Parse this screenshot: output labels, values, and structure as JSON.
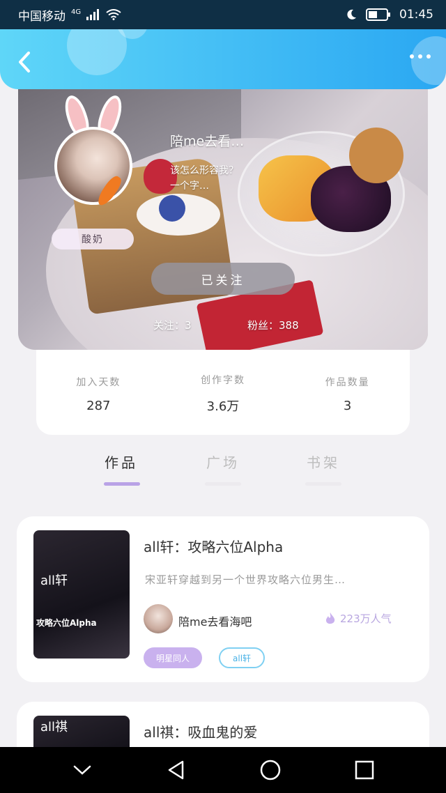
{
  "status_bar": {
    "carrier": "中国移动",
    "network": "4G",
    "time": "01:45"
  },
  "profile": {
    "username": "陪me去看…",
    "bio_line1": "该怎么形容我？",
    "bio_line2": "一个字…",
    "nickname_badge": "酸奶",
    "follow_button": "已关注",
    "following_text": "关注：3",
    "fans_text": "粉丝：388"
  },
  "stats": [
    {
      "label": "加入天数",
      "value": "287"
    },
    {
      "label": "创作字数",
      "value": "3.6万"
    },
    {
      "label": "作品数量",
      "value": "3"
    }
  ],
  "tabs": [
    {
      "label": "作品",
      "active": true
    },
    {
      "label": "广场",
      "active": false
    },
    {
      "label": "书架",
      "active": false
    }
  ],
  "works": [
    {
      "title": "all轩：攻略六位Alpha",
      "description": "宋亚轩穿越到另一个世界攻略六位男生…",
      "cover_text_1": "all轩",
      "cover_text_2": "攻略六位Alpha",
      "author": "陪me去看海吧",
      "popularity": "223万人气",
      "tags": [
        "明星同人",
        "all轩"
      ]
    },
    {
      "title": "all祺：吸血鬼的爱",
      "cover_text_1": "all祺"
    }
  ],
  "icons": {
    "back": "chevron-left-icon",
    "more": "more-dots-icon",
    "popularity": "flame-icon",
    "nav": [
      "nav-down-icon",
      "nav-back-icon",
      "nav-home-icon",
      "nav-recent-icon"
    ]
  },
  "colors": {
    "header_start": "#5fd6f8",
    "header_end": "#2aa7f2",
    "accent_purple": "#b9a2e6",
    "tag_purple": "#c9b1ee",
    "tag_blue": "#7fd0f2"
  }
}
